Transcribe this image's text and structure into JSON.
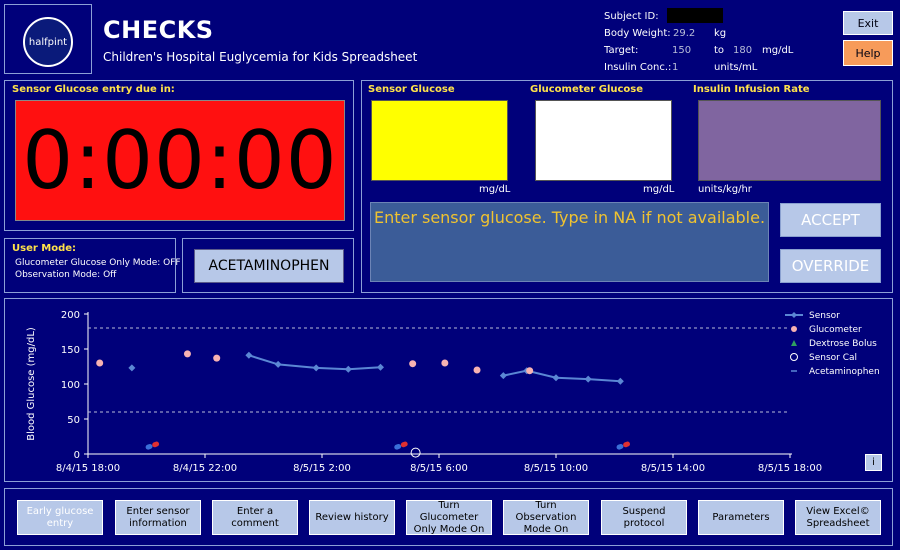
{
  "header": {
    "logo_text": "halfpint",
    "title": "CHECKS",
    "subtitle": "Children's Hospital Euglycemia for Kids Spreadsheet"
  },
  "subject": {
    "id_label": "Subject ID:",
    "weight_label": "Body Weight:",
    "weight_value": "29.2",
    "weight_unit": "kg",
    "target_label": "Target:",
    "target_low": "150",
    "target_to": "to",
    "target_high": "180",
    "target_unit": "mg/dL",
    "insulin_label": "Insulin Conc.:",
    "insulin_value": "1",
    "insulin_unit": "units/mL"
  },
  "controls": {
    "exit": "Exit",
    "help": "Help",
    "colors": {
      "exit": "#b7c8e8",
      "help": "#f79b5a"
    }
  },
  "timer": {
    "label": "Sensor Glucose entry due in:",
    "value": "0:00:00",
    "color": "#ff1010"
  },
  "user_mode": {
    "label": "User Mode:",
    "glucometer_only": "Glucometer Glucose Only Mode: OFF",
    "observation": "Observation Mode: Off"
  },
  "acetaminophen_button": "ACETAMINOPHEN",
  "glucose": {
    "sensor_label": "Sensor Glucose",
    "sensor_unit": "mg/dL",
    "sensor_color": "#ffff00",
    "glucometer_label": "Glucometer Glucose",
    "glucometer_unit": "mg/dL",
    "glucometer_color": "#ffffff",
    "insulin_label": "Insulin Infusion Rate",
    "insulin_unit": "units/kg/hr",
    "insulin_color": "#8065a0"
  },
  "message": "Enter sensor glucose. Type in NA if not available.",
  "accept": "ACCEPT",
  "override": "OVERRIDE",
  "chart_data": {
    "type": "line",
    "ylabel": "Blood Glucose (mg/dL)",
    "ylim": [
      0,
      200
    ],
    "y_ticks": [
      "0",
      "50",
      "100",
      "150",
      "200"
    ],
    "x_ticks": [
      "8/4/15 18:00",
      "8/4/15 22:00",
      "8/5/15 2:00",
      "8/5/15 6:00",
      "8/5/15 10:00",
      "8/5/15 14:00",
      "8/5/15 18:00"
    ],
    "x_tick_hours": [
      0,
      4,
      8,
      12,
      16,
      20,
      24
    ],
    "target_lines": [
      180,
      60
    ],
    "series": [
      {
        "name": "Sensor",
        "color": "#5b87d4",
        "segments": [
          [
            [
              1.5,
              123
            ]
          ],
          [
            [
              5.5,
              141
            ],
            [
              6.5,
              128
            ],
            [
              7.8,
              123
            ],
            [
              8.9,
              121
            ],
            [
              10.0,
              124
            ]
          ],
          [
            [
              14.2,
              112
            ],
            [
              15.0,
              119
            ],
            [
              16.0,
              109
            ],
            [
              17.1,
              107
            ],
            [
              18.2,
              104
            ]
          ]
        ]
      },
      {
        "name": "Glucometer",
        "color": "#f7b2b2",
        "points": [
          [
            0.4,
            130
          ],
          [
            3.4,
            143
          ],
          [
            4.4,
            137
          ],
          [
            11.1,
            129
          ],
          [
            12.2,
            130
          ],
          [
            13.3,
            120
          ],
          [
            15.1,
            119
          ]
        ]
      },
      {
        "name": "Dextrose Bolus",
        "color": "#30a060",
        "points": []
      },
      {
        "name": "Sensor Cal",
        "color": "#ffffff",
        "points": [
          [
            11.2,
            2
          ]
        ]
      },
      {
        "name": "Acetaminophen",
        "color": "#5b87d4",
        "points": [
          [
            2.2,
            12
          ],
          [
            10.7,
            12
          ],
          [
            18.3,
            12
          ]
        ]
      }
    ],
    "legend": [
      "Sensor",
      "Glucometer",
      "Dextrose Bolus",
      "Sensor Cal",
      "Acetaminophen"
    ],
    "legend_position": "top-right"
  },
  "chart_info_button": "i",
  "nav": [
    {
      "label": "Early glucose entry",
      "enabled": false
    },
    {
      "label": "Enter sensor information",
      "enabled": true
    },
    {
      "label": "Enter a comment",
      "enabled": true
    },
    {
      "label": "Review history",
      "enabled": true
    },
    {
      "label": "Turn Glucometer Only Mode On",
      "enabled": true
    },
    {
      "label": "Turn Observation Mode On",
      "enabled": true
    },
    {
      "label": "Suspend protocol",
      "enabled": true
    },
    {
      "label": "Parameters",
      "enabled": true
    },
    {
      "label": "View Excel© Spreadsheet",
      "enabled": true
    }
  ]
}
